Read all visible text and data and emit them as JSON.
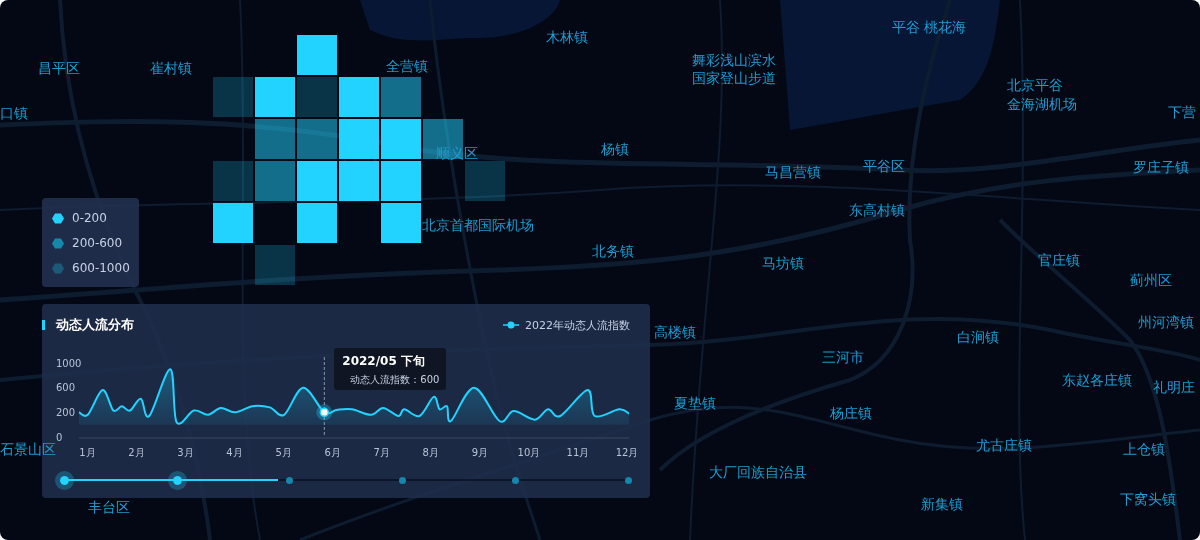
{
  "map": {
    "labels": [
      {
        "text": "昌平区"
      },
      {
        "text": "崔村镇"
      },
      {
        "text": "口镇"
      },
      {
        "text": "全营镇"
      },
      {
        "text": "木林镇"
      },
      {
        "text": "舞彩浅山滨水"
      },
      {
        "text": "国家登山步道"
      },
      {
        "text": "平谷 桃花海"
      },
      {
        "text": "北京平谷"
      },
      {
        "text": "金海湖机场"
      },
      {
        "text": "下营"
      },
      {
        "text": "顺义区"
      },
      {
        "text": "杨镇"
      },
      {
        "text": "马昌营镇"
      },
      {
        "text": "平谷区"
      },
      {
        "text": "罗庄子镇"
      },
      {
        "text": "北京首都国际机场"
      },
      {
        "text": "东高村镇"
      },
      {
        "text": "北务镇"
      },
      {
        "text": "马坊镇"
      },
      {
        "text": "官庄镇"
      },
      {
        "text": "蓟州区"
      },
      {
        "text": "州河湾镇"
      },
      {
        "text": "高楼镇"
      },
      {
        "text": "白涧镇"
      },
      {
        "text": "三河市"
      },
      {
        "text": "东赵各庄镇"
      },
      {
        "text": "礼明庄"
      },
      {
        "text": "夏垫镇"
      },
      {
        "text": "杨庄镇"
      },
      {
        "text": "尤古庄镇"
      },
      {
        "text": "上仓镇"
      },
      {
        "text": "大厂回族自治县"
      },
      {
        "text": "新集镇"
      },
      {
        "text": "下窝头镇"
      },
      {
        "text": "石景山区"
      },
      {
        "text": "丰台区"
      }
    ]
  },
  "heat_grid": {
    "rows": [
      [
        {
          "kind": "empty"
        },
        {
          "kind": "empty"
        },
        {
          "kind": "low"
        },
        {
          "kind": "empty"
        },
        {
          "kind": "empty"
        },
        {
          "kind": "empty"
        },
        {
          "kind": "empty"
        }
      ],
      [
        {
          "kind": "high"
        },
        {
          "kind": "low"
        },
        {
          "kind": "high"
        },
        {
          "kind": "low"
        },
        {
          "kind": "mid"
        },
        {
          "kind": "empty"
        },
        {
          "kind": "empty"
        }
      ],
      [
        {
          "kind": "empty"
        },
        {
          "kind": "mid"
        },
        {
          "kind": "mid"
        },
        {
          "kind": "low"
        },
        {
          "kind": "low"
        },
        {
          "kind": "mid"
        },
        {
          "kind": "empty"
        }
      ],
      [
        {
          "kind": "high"
        },
        {
          "kind": "mid"
        },
        {
          "kind": "low"
        },
        {
          "kind": "low"
        },
        {
          "kind": "low"
        },
        {
          "kind": "empty"
        },
        {
          "kind": "high"
        }
      ],
      [
        {
          "kind": "low"
        },
        {
          "kind": "empty"
        },
        {
          "kind": "low"
        },
        {
          "kind": "empty"
        },
        {
          "kind": "low"
        },
        {
          "kind": "empty"
        },
        {
          "kind": "empty"
        }
      ],
      [
        {
          "kind": "empty"
        },
        {
          "kind": "high"
        },
        {
          "kind": "empty"
        },
        {
          "kind": "empty"
        },
        {
          "kind": "empty"
        },
        {
          "kind": "empty"
        },
        {
          "kind": "empty"
        }
      ]
    ]
  },
  "legend": {
    "items": [
      {
        "label": "0-200",
        "color": "#22d3ff"
      },
      {
        "label": "200-600",
        "color": "#1688aa"
      },
      {
        "label": "600-1000",
        "color": "#1d5a7a"
      }
    ]
  },
  "flow_panel": {
    "title": "动态人流分布",
    "tooltip": {
      "title": "2022/05 下旬",
      "text": "动态人流指数：600"
    },
    "y_axis_base_label": "0",
    "chart_data": {
      "type": "area",
      "xlim": [
        0.83,
        12.04
      ],
      "ylim": [
        -200,
        1000
      ],
      "xticks": [
        {
          "value": 1,
          "label": "1月"
        },
        {
          "value": 2,
          "label": "2月"
        },
        {
          "value": 3,
          "label": "3月"
        },
        {
          "value": 4,
          "label": "4月"
        },
        {
          "value": 5,
          "label": "5月"
        },
        {
          "value": 6,
          "label": "6月"
        },
        {
          "value": 7,
          "label": "7月"
        },
        {
          "value": 8,
          "label": "8月"
        },
        {
          "value": 9,
          "label": "9月"
        },
        {
          "value": 10,
          "label": "10月"
        },
        {
          "value": 11,
          "label": "11月"
        },
        {
          "value": 12,
          "label": "12月"
        }
      ],
      "yticks": [
        200,
        600,
        1000
      ],
      "x": [
        0.83,
        1.01,
        1.31,
        1.53,
        1.7,
        1.87,
        2.09,
        2.26,
        2.69,
        2.82,
        3.17,
        3.46,
        3.72,
        4.01,
        4.37,
        4.72,
        5.01,
        5.4,
        5.83,
        6.08,
        6.39,
        6.78,
        7.03,
        7.34,
        7.46,
        7.77,
        8.06,
        8.18,
        8.33,
        8.41,
        8.88,
        9.4,
        9.69,
        10.12,
        10.39,
        10.64,
        11.2,
        11.34,
        11.84,
        12.04
      ],
      "series": [
        {
          "name": "2022年动态人流指数",
          "color": "#22d3ff",
          "values": [
            200,
            160,
            560,
            230,
            300,
            230,
            420,
            140,
            900,
            40,
            230,
            160,
            270,
            200,
            300,
            280,
            160,
            600,
            200,
            240,
            250,
            160,
            270,
            140,
            250,
            140,
            450,
            250,
            300,
            60,
            600,
            60,
            220,
            80,
            250,
            140,
            560,
            140,
            250,
            180
          ]
        }
      ],
      "ref_lines": [
        {
          "axis": "x",
          "value": 5.83
        }
      ]
    },
    "timeline": {
      "level": 0.38,
      "nodes": [
        {
          "selected": true
        },
        {
          "selected": true
        },
        {
          "selected": false
        },
        {
          "selected": false
        },
        {
          "selected": false
        },
        {
          "selected": false
        }
      ]
    }
  }
}
